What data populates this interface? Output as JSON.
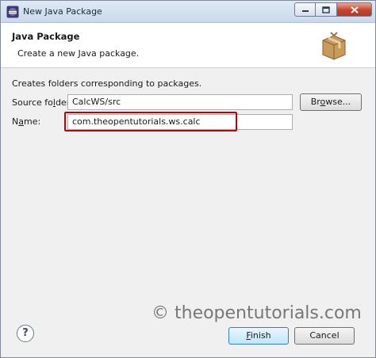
{
  "window": {
    "title": "New Java Package"
  },
  "header": {
    "title": "Java Package",
    "description": "Create a new Java package."
  },
  "form": {
    "info_text": "Creates folders corresponding to packages.",
    "source_folder_label_pre": "Source fo",
    "source_folder_label_mnemonic": "l",
    "source_folder_label_post": "der:",
    "source_folder_value": "CalcWS/src",
    "browse_label_pre": "Br",
    "browse_label_mnemonic": "o",
    "browse_label_post": "wse...",
    "name_label_pre": "N",
    "name_label_mnemonic": "a",
    "name_label_post": "me:",
    "name_value": "com.theopentutorials.ws.calc"
  },
  "watermark": "© theopentutorials.com",
  "footer": {
    "help_symbol": "?",
    "finish_label_mnemonic": "F",
    "finish_label_rest": "inish",
    "cancel_label": "Cancel"
  },
  "colors": {
    "highlight_border": "#c00000",
    "header_bg": "#ffffff",
    "dialog_bg": "#f0f0f0"
  }
}
